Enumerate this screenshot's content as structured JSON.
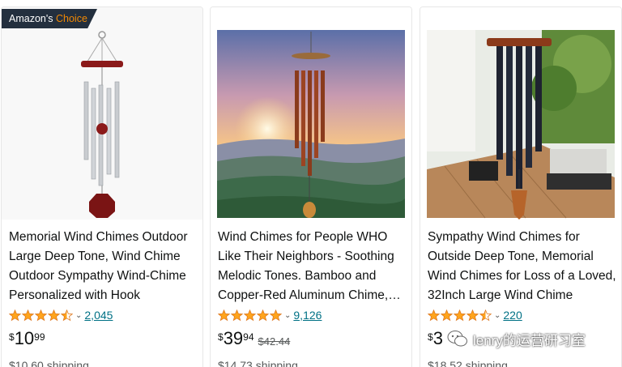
{
  "badge": {
    "prefix": "Amazon's",
    "highlight": "Choice"
  },
  "products": [
    {
      "title": "Memorial Wind Chimes Outdoor Large Deep Tone, Wind Chime Outdoor Sympathy Wind-Chime Personalized with Hook",
      "rating": 4.5,
      "review_count": "2,045",
      "price_symbol": "$",
      "price_whole": "10",
      "price_fraction": "99",
      "list_price": "",
      "shipping": "$10.60 shipping"
    },
    {
      "title": "Wind Chimes for People WHO Like Their Neighbors - Soothing Melodic Tones. Bamboo and Copper-Red Aluminum Chime, Outdoor",
      "rating": 5,
      "review_count": "9,126",
      "price_symbol": "$",
      "price_whole": "39",
      "price_fraction": "94",
      "list_price": "$42.44",
      "shipping": "$14.73 shipping"
    },
    {
      "title": "Sympathy Wind Chimes for Outside Deep Tone, Memorial Wind Chimes for Loss of a Loved, 32Inch Large Wind Chime",
      "rating": 4.5,
      "review_count": "220",
      "price_symbol": "$",
      "price_whole": "3",
      "price_fraction": "",
      "list_price": "",
      "shipping": "$18.52 shipping"
    }
  ],
  "watermark": "lenry的运营研习室",
  "colors": {
    "star": "#ffa41c",
    "link": "#007185",
    "badge_bg": "#232f3e",
    "badge_accent": "#f08804"
  }
}
